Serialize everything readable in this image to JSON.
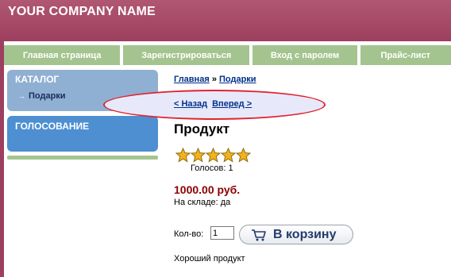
{
  "header": {
    "company_name": "YOUR COMPANY NAME"
  },
  "nav": {
    "items": [
      {
        "label": "Главная страница"
      },
      {
        "label": "Зарегистрироваться"
      },
      {
        "label": "Вход с паролем"
      },
      {
        "label": "Прайс-лист"
      }
    ]
  },
  "sidebar": {
    "catalog": {
      "title": "КАТАЛОГ",
      "items": [
        {
          "label": "Подарки"
        }
      ]
    },
    "vote": {
      "title": "ГОЛОСОВАНИЕ"
    }
  },
  "breadcrumb": {
    "home": "Главная",
    "separator": "»",
    "current": "Подарки"
  },
  "pager": {
    "back": "< Назад",
    "forward": "Вперед >"
  },
  "product": {
    "title": "Продукт",
    "rating": {
      "value": 5,
      "max": 5
    },
    "votes_text": "Голосов: 1",
    "price": "1000.00 руб.",
    "stock": "На складе: да",
    "qty_label": "Кол-во:",
    "qty_value": "1",
    "add_to_cart": "В корзину",
    "description": "Хороший продукт"
  },
  "colors": {
    "header": "#9d3f5e",
    "nav": "#a3c48f",
    "catalog_box": "#8fb0d2",
    "vote_box": "#4d8fd1",
    "price": "#8b0000",
    "annotation_ellipse": "#e0242f"
  }
}
